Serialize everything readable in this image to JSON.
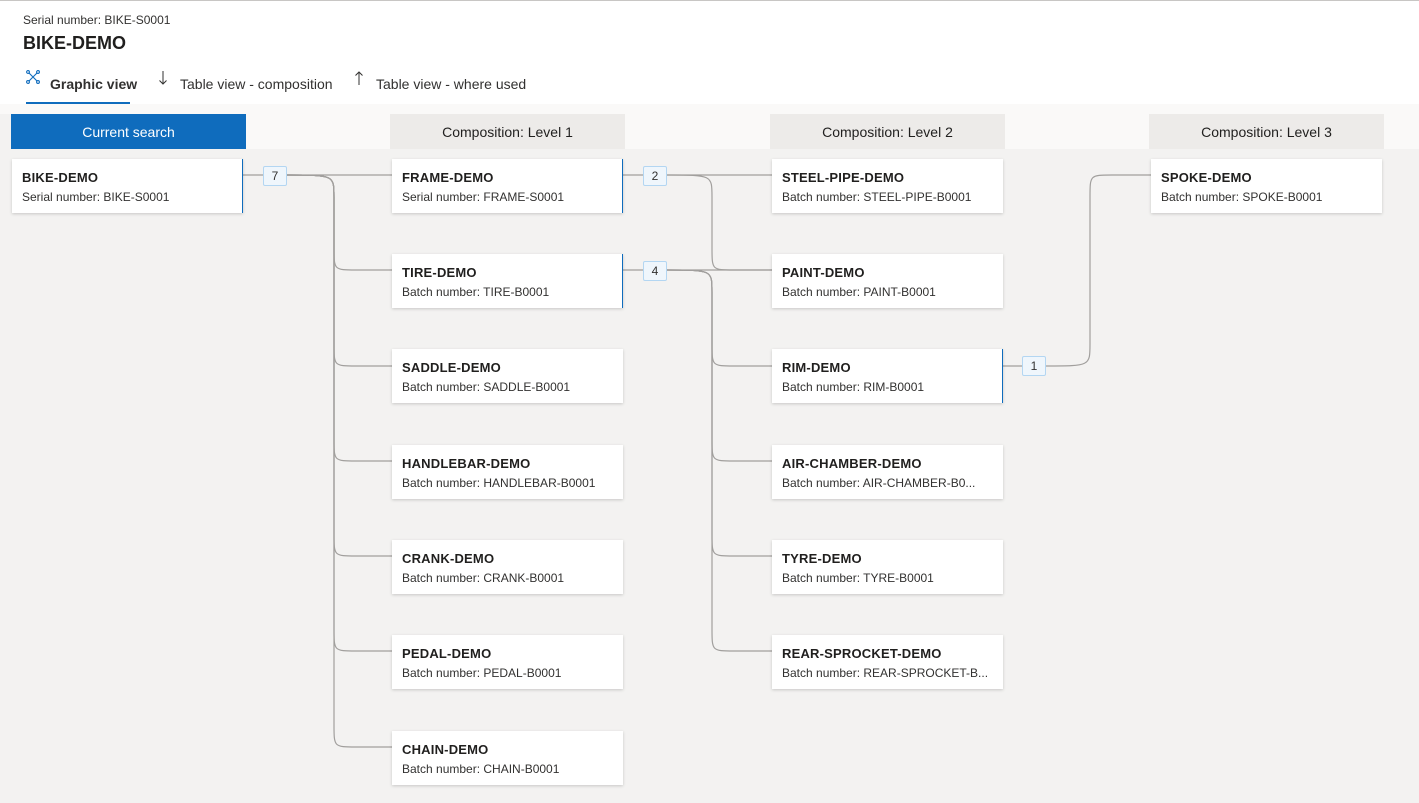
{
  "header": {
    "subtitle": "Serial number: BIKE-S0001",
    "title": "BIKE-DEMO"
  },
  "tabs": [
    {
      "label": "Graphic view",
      "icon": "graph-icon",
      "active": true
    },
    {
      "label": "Table view - composition",
      "icon": "arrow-down-icon",
      "active": false
    },
    {
      "label": "Table view - where used",
      "icon": "arrow-up-icon",
      "active": false
    }
  ],
  "columns": [
    {
      "label": "Current search"
    },
    {
      "label": "Composition: Level 1"
    },
    {
      "label": "Composition: Level 2"
    },
    {
      "label": "Composition: Level 3"
    }
  ],
  "root": {
    "name": "BIKE-DEMO",
    "sub": "Serial number: BIKE-S0001",
    "count": "7"
  },
  "level1": [
    {
      "name": "FRAME-DEMO",
      "sub": "Serial number: FRAME-S0001",
      "count": "2"
    },
    {
      "name": "TIRE-DEMO",
      "sub": "Batch number: TIRE-B0001",
      "count": "4"
    },
    {
      "name": "SADDLE-DEMO",
      "sub": "Batch number: SADDLE-B0001"
    },
    {
      "name": "HANDLEBAR-DEMO",
      "sub": "Batch number: HANDLEBAR-B0001"
    },
    {
      "name": "CRANK-DEMO",
      "sub": "Batch number: CRANK-B0001"
    },
    {
      "name": "PEDAL-DEMO",
      "sub": "Batch number: PEDAL-B0001"
    },
    {
      "name": "CHAIN-DEMO",
      "sub": "Batch number: CHAIN-B0001"
    }
  ],
  "level2": [
    {
      "name": "STEEL-PIPE-DEMO",
      "sub": "Batch number: STEEL-PIPE-B0001"
    },
    {
      "name": "PAINT-DEMO",
      "sub": "Batch number: PAINT-B0001"
    },
    {
      "name": "RIM-DEMO",
      "sub": "Batch number: RIM-B0001",
      "count": "1"
    },
    {
      "name": "AIR-CHAMBER-DEMO",
      "sub": "Batch number: AIR-CHAMBER-B0..."
    },
    {
      "name": "TYRE-DEMO",
      "sub": "Batch number: TYRE-B0001"
    },
    {
      "name": "REAR-SPROCKET-DEMO",
      "sub": "Batch number: REAR-SPROCKET-B..."
    }
  ],
  "level3": [
    {
      "name": "SPOKE-DEMO",
      "sub": "Batch number: SPOKE-B0001"
    }
  ],
  "colors": {
    "accent": "#0f6cbd",
    "canvas": "#f3f2f1",
    "line": "#8a8886"
  }
}
